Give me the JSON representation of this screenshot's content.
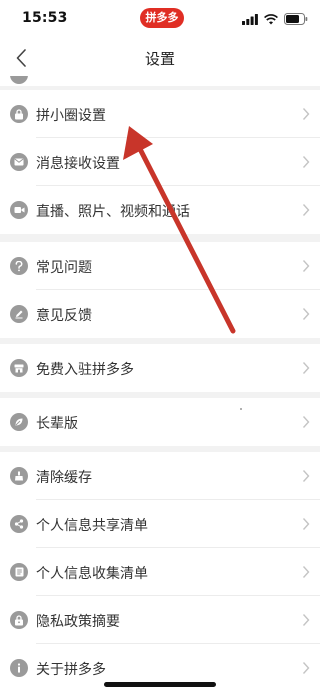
{
  "status_bar": {
    "time": "15:53",
    "app_badge": "拼多多"
  },
  "nav": {
    "title": "设置"
  },
  "groups": [
    {
      "items": [
        {
          "label": "拼小圈设置",
          "icon": "lock-icon"
        },
        {
          "label": "消息接收设置",
          "icon": "envelope-icon"
        },
        {
          "label": "直播、照片、视频和通话",
          "icon": "video-camera-icon"
        }
      ]
    },
    {
      "items": [
        {
          "label": "常见问题",
          "icon": "question-icon"
        },
        {
          "label": "意见反馈",
          "icon": "pencil-icon"
        }
      ]
    },
    {
      "items": [
        {
          "label": "免费入驻拼多多",
          "icon": "store-icon"
        }
      ]
    },
    {
      "items": [
        {
          "label": "长辈版",
          "icon": "leaf-icon"
        }
      ]
    },
    {
      "items": [
        {
          "label": "清除缓存",
          "icon": "broom-icon"
        },
        {
          "label": "个人信息共享清单",
          "icon": "share-icon"
        },
        {
          "label": "个人信息收集清单",
          "icon": "list-icon"
        },
        {
          "label": "隐私政策摘要",
          "icon": "padlock-icon"
        },
        {
          "label": "关于拼多多",
          "icon": "info-icon"
        }
      ]
    }
  ],
  "colors": {
    "brand": "#e02e24",
    "arrow": "#c8352a",
    "icon_gray": "#9a9a9a"
  }
}
